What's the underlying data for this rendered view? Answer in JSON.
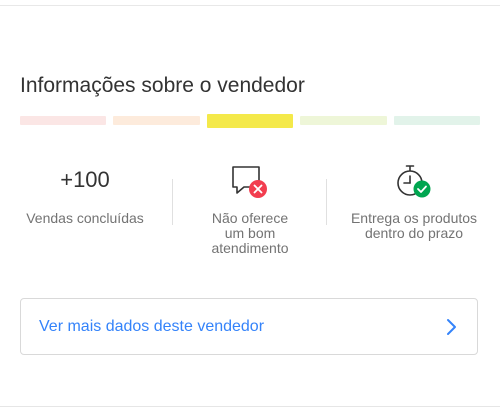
{
  "section": {
    "title": "Informações sobre o vendedor"
  },
  "reputation": {
    "segments": [
      {
        "level": "red",
        "color": "#fbe6e5",
        "active": false
      },
      {
        "level": "orange",
        "color": "#fdebdc",
        "active": false
      },
      {
        "level": "yellow",
        "color": "#f4e94a",
        "active": true
      },
      {
        "level": "light-green",
        "color": "#eef6d8",
        "active": false
      },
      {
        "level": "green",
        "color": "#e2f3ea",
        "active": false
      }
    ]
  },
  "stats": {
    "sales_value": "+100",
    "sales_label": "Vendas concluídas",
    "service_label_line1": "Não oferece",
    "service_label_line2": "um bom",
    "service_label_line3": "atendimento",
    "service_icon": "chat-bubble-with-error-icon",
    "delivery_label_line1": "Entrega os produtos",
    "delivery_label_line2": "dentro do prazo",
    "delivery_icon": "stopwatch-with-check-icon"
  },
  "more": {
    "link_label": "Ver mais dados deste vendedor"
  },
  "colors": {
    "link": "#3483fa",
    "error": "#f23d4f",
    "success": "#00a650"
  }
}
